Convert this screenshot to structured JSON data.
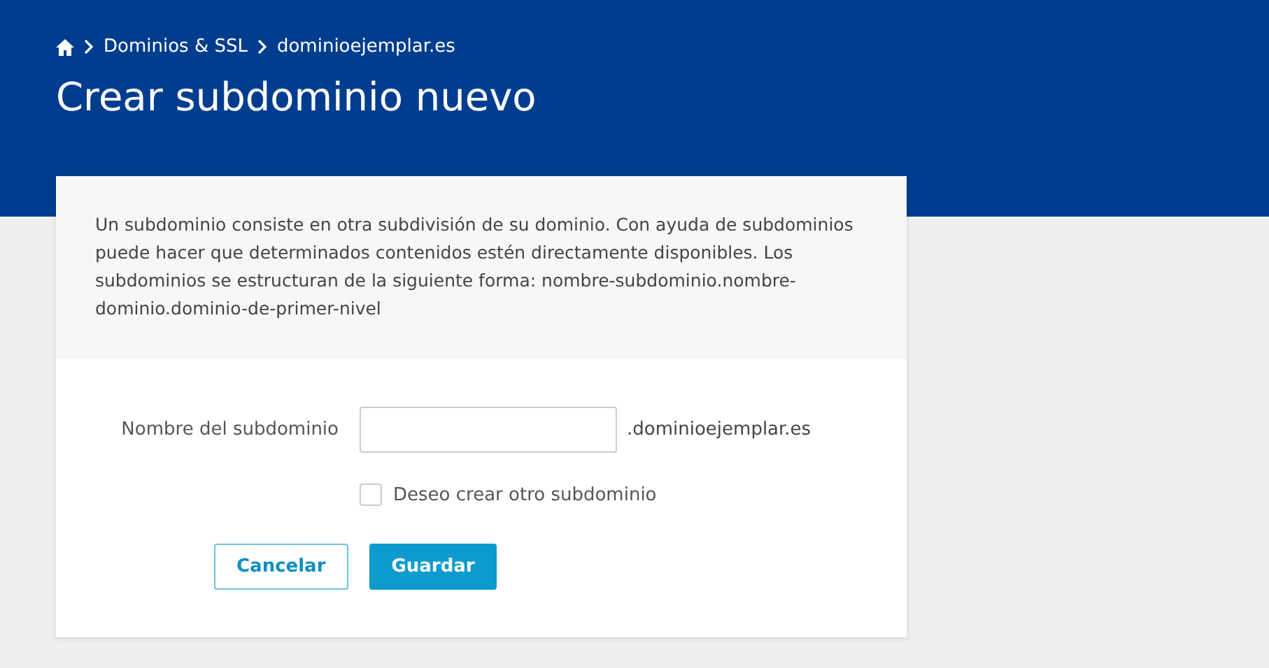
{
  "breadcrumb": [
    "Dominios & SSL",
    "dominioejemplar.es"
  ],
  "title": "Crear subdominio nuevo",
  "intro": "Un subdominio consiste en otra subdivisión de su dominio. Con ayuda de subdominios puede hacer que determinados contenidos estén directamente disponibles. Los subdominios se estructuran de la siguiente forma: nombre-subdominio.nombre-dominio.dominio-de-primer-nivel",
  "form": {
    "field_label": "Nombre del subdominio",
    "suffix": ".dominioejemplar.es",
    "checkbox": {
      "label": "Deseo crear otro subdominio",
      "checked": false
    }
  },
  "buttons": [
    {
      "label": "Cancelar",
      "kind": "secondary"
    },
    {
      "label": "Guardar",
      "kind": "primary"
    }
  ]
}
